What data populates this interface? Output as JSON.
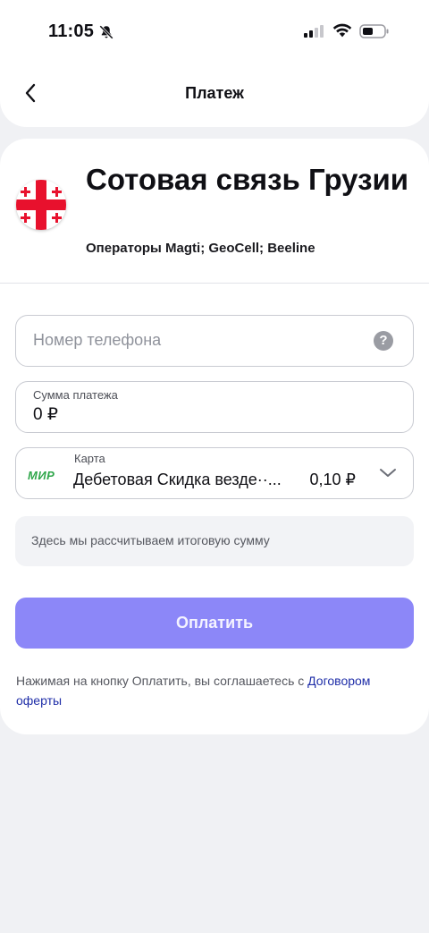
{
  "status_bar": {
    "time": "11:05",
    "icons": [
      "bell-off-icon",
      "signal-icon",
      "wifi-icon",
      "battery-icon"
    ]
  },
  "header": {
    "title": "Платеж",
    "back_icon": "chevron-left-icon"
  },
  "service": {
    "title": "Сотовая связь Грузии",
    "subtitle": "Операторы Magti; GeoCell; Beeline",
    "flag_icon": "georgia-flag-icon"
  },
  "form": {
    "phone": {
      "placeholder": "Номер телефона",
      "value": "",
      "help_icon": "question-icon",
      "help_glyph": "?"
    },
    "amount": {
      "label": "Сумма платежа",
      "value": "0 ₽"
    },
    "card": {
      "label": "Карта",
      "brand": "МИР",
      "name": "Дебетовая Скидка везде··...",
      "balance": "0,10 ₽",
      "dropdown_icon": "chevron-down-icon"
    },
    "calculation_note": "Здесь мы рассчитываем итоговую сумму"
  },
  "actions": {
    "pay_label": "Оплатить"
  },
  "legal": {
    "text": "Нажимая на кнопку Оплатить, вы соглашаетесь с ",
    "link": "Договором оферты"
  },
  "colors": {
    "accent": "#8c87f8",
    "link": "#1f2ea8",
    "background": "#f0f1f4",
    "mir_green": "#2fa64a"
  }
}
